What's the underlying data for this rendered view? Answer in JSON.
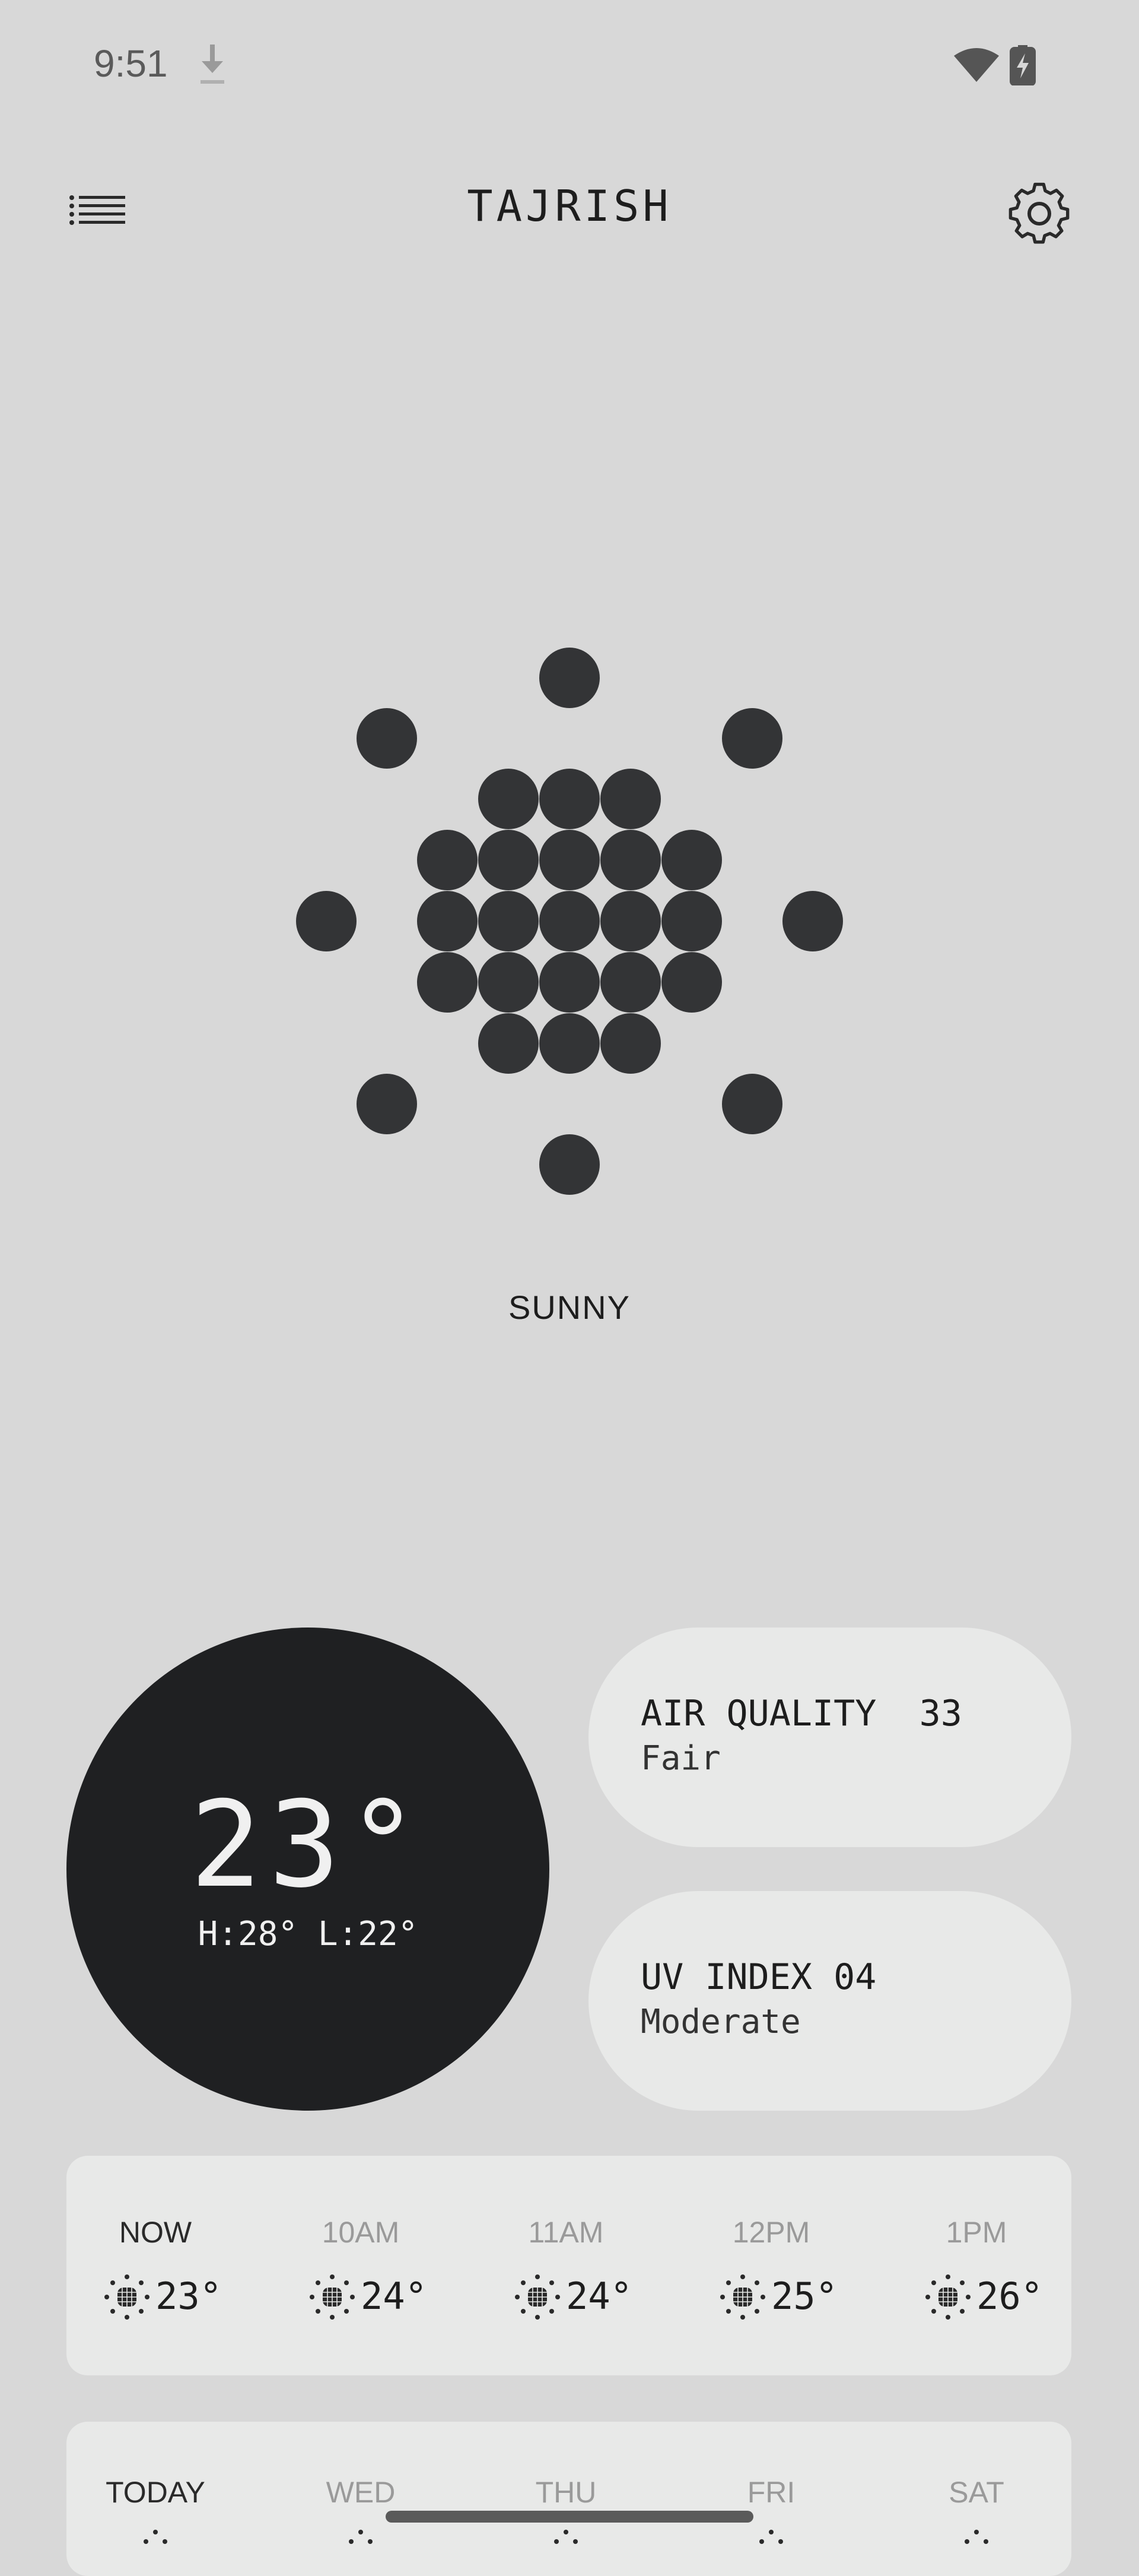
{
  "status_bar": {
    "time": "9:51"
  },
  "header": {
    "title": "TAJRISH"
  },
  "current": {
    "condition": "SUNNY",
    "temperature": "23°",
    "high_low": "H:28° L:22°"
  },
  "air_quality": {
    "title": "AIR QUALITY  33",
    "label": "Fair"
  },
  "uv_index": {
    "title": "UV INDEX 04",
    "label": "Moderate"
  },
  "hourly": [
    {
      "time": "NOW",
      "temp": "23°",
      "icon": "sun-icon"
    },
    {
      "time": "10AM",
      "temp": "24°",
      "icon": "sun-icon"
    },
    {
      "time": "11AM",
      "temp": "24°",
      "icon": "sun-icon"
    },
    {
      "time": "12PM",
      "temp": "25°",
      "icon": "sun-icon"
    },
    {
      "time": "1PM",
      "temp": "26°",
      "icon": "sun-icon"
    }
  ],
  "daily": [
    {
      "day": "TODAY"
    },
    {
      "day": "WED"
    },
    {
      "day": "THU"
    },
    {
      "day": "FRI"
    },
    {
      "day": "SAT"
    }
  ],
  "colors": {
    "background": "#d8d8d8",
    "dark": "#1f2022",
    "card": "#e8e9e8",
    "dot": "#333436"
  }
}
